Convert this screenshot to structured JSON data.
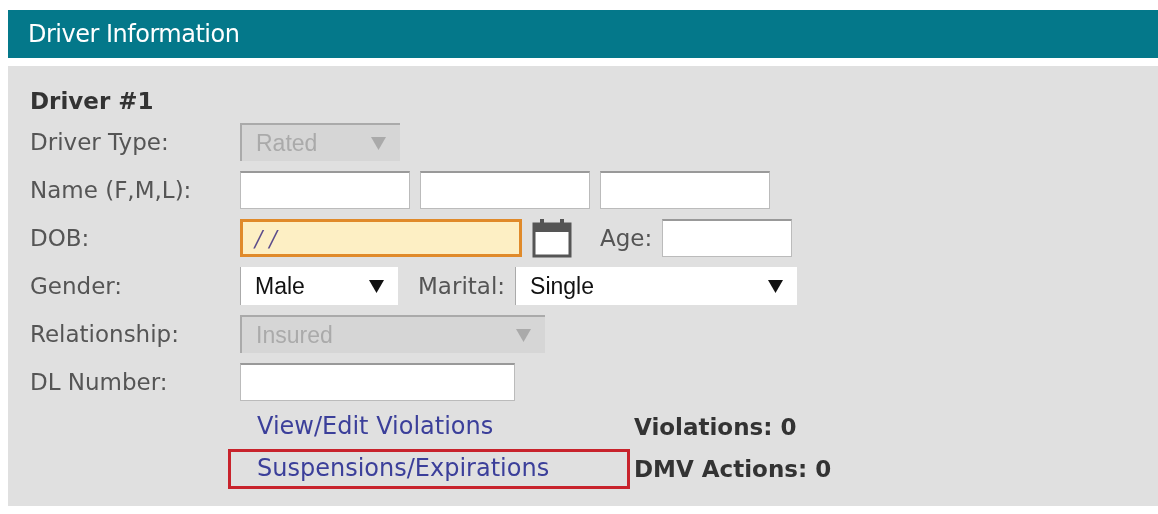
{
  "header": {
    "title": "Driver Information"
  },
  "driver": {
    "heading": "Driver #1",
    "driver_type": {
      "label": "Driver Type:",
      "value": "Rated",
      "disabled": true
    },
    "name": {
      "label": "Name (F,M,L):"
    },
    "dob": {
      "label": "DOB:",
      "value": "/ /",
      "focused": true
    },
    "age": {
      "label": "Age:"
    },
    "gender": {
      "label": "Gender:",
      "value": "Male",
      "disabled": false
    },
    "marital": {
      "label": "Marital:",
      "value": "Single",
      "disabled": false
    },
    "relationship": {
      "label": "Relationship:",
      "value": "Insured",
      "disabled": true
    },
    "dl_number": {
      "label": "DL Number:"
    },
    "links": [
      {
        "label": "View/Edit Violations",
        "highlighted": false,
        "count": "Violations: 0"
      },
      {
        "label": "Suspensions/Expirations",
        "highlighted": true,
        "count": "DMV Actions: 0"
      }
    ]
  }
}
